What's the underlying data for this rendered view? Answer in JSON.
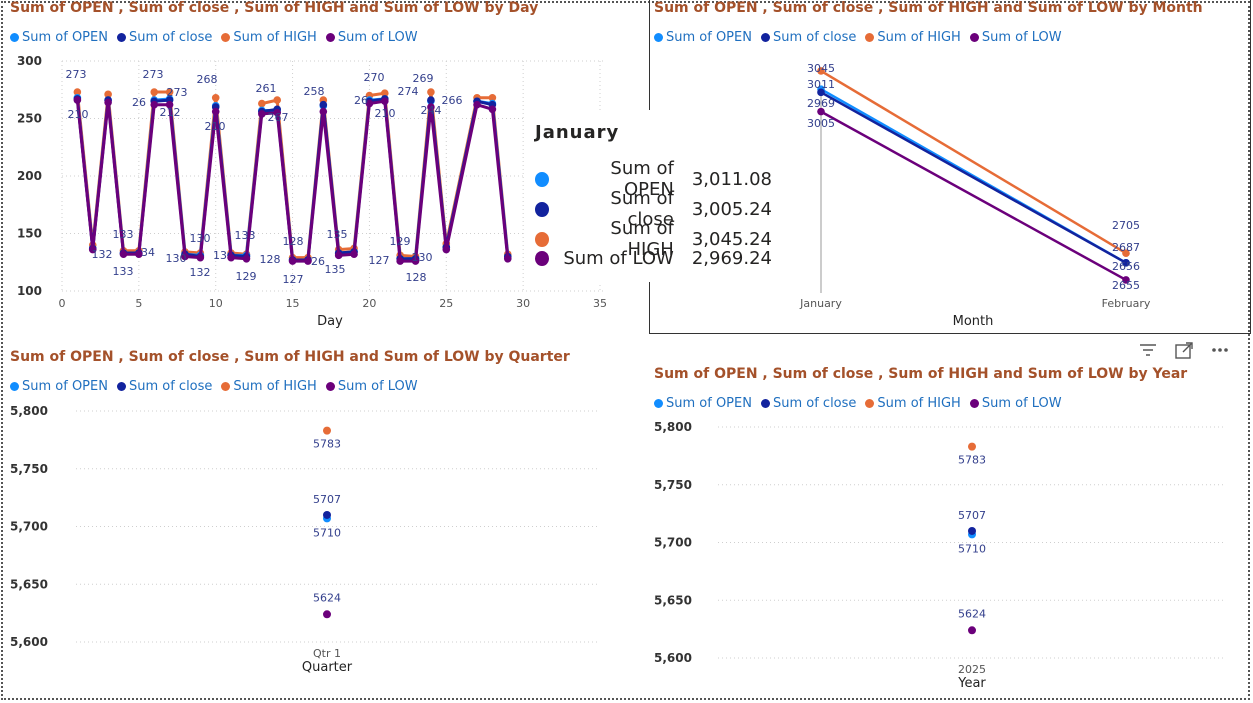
{
  "series_colors": [
    "#118dff",
    "#12239e",
    "#e66c37",
    "#6b007b"
  ],
  "legend_labels": [
    "Sum of OPEN",
    "Sum of close",
    "Sum of HIGH",
    "Sum of LOW"
  ],
  "day_chart": {
    "title": "Sum of OPEN , Sum of close , Sum of HIGH and Sum of LOW by Day",
    "xlabel": "Day",
    "xticks": [
      "0",
      "5",
      "10",
      "15",
      "20",
      "25",
      "30",
      "35"
    ],
    "yticks": [
      "100",
      "150",
      "200",
      "250",
      "300"
    ],
    "top_labels": [
      {
        "day": 1,
        "text": "273"
      },
      {
        "day": 6,
        "text": "273"
      },
      {
        "day": 10,
        "text": "268"
      },
      {
        "day": 14,
        "text": "261"
      },
      {
        "day": 17,
        "text": "258"
      },
      {
        "day": 21,
        "text": "270"
      },
      {
        "day": 24,
        "text": "269"
      }
    ],
    "other_labels": [
      "210",
      "132",
      "133",
      "133",
      "34",
      "26",
      "212",
      "273",
      "130",
      "130",
      "132",
      "210",
      "13",
      "133",
      "129",
      "128",
      "267",
      "128",
      "127",
      "26",
      "135",
      "135",
      "26",
      "210",
      "274",
      "127",
      "129",
      "130",
      "128",
      "244",
      "266"
    ]
  },
  "month_chart": {
    "title": "Sum of OPEN , Sum of close , Sum of HIGH and Sum of LOW by Month",
    "xlabel": "Month",
    "categories": [
      "January",
      "February"
    ],
    "jan_labels": [
      "3045",
      "3011",
      "2969",
      "3005"
    ],
    "feb_labels": [
      "2705",
      "2687",
      "2656",
      "2655"
    ]
  },
  "tooltip": {
    "title": "January",
    "rows": [
      {
        "label": "Sum of OPEN",
        "value": "3,011.08"
      },
      {
        "label": "Sum of close",
        "value": "3,005.24"
      },
      {
        "label": "Sum of HIGH",
        "value": "3,045.24"
      },
      {
        "label": "Sum of LOW",
        "value": "2,969.24"
      }
    ]
  },
  "quarter_chart": {
    "title": "Sum of OPEN , Sum of close , Sum of HIGH and Sum of LOW by Quarter",
    "xlabel": "Quarter",
    "category": "Qtr 1",
    "yticks": [
      "5,800",
      "5,750",
      "5,700",
      "5,650",
      "5,600"
    ],
    "labels": [
      "5783",
      "5707",
      "5710",
      "5624"
    ]
  },
  "year_chart": {
    "title": "Sum of OPEN , Sum of close , Sum of HIGH and Sum of LOW by Year",
    "xlabel": "Year",
    "category": "2025",
    "yticks": [
      "5,800",
      "5,750",
      "5,700",
      "5,650",
      "5,600"
    ],
    "labels": [
      "5783",
      "5707",
      "5710",
      "5624"
    ]
  },
  "chart_data": [
    {
      "type": "line",
      "title": "Sum of OPEN , Sum of close , Sum of HIGH and Sum of LOW by Day",
      "xlabel": "Day",
      "ylabel": "",
      "xlim": [
        0,
        35
      ],
      "ylim": [
        100,
        300
      ],
      "x": [
        1,
        2,
        3,
        4,
        5,
        6,
        7,
        8,
        9,
        10,
        11,
        12,
        13,
        14,
        15,
        16,
        17,
        18,
        19,
        20,
        21,
        22,
        23,
        24,
        25,
        27,
        28,
        29
      ],
      "series": [
        {
          "name": "Sum of OPEN",
          "values": [
            268,
            137,
            266,
            133,
            133,
            266,
            267,
            132,
            131,
            261,
            131,
            131,
            257,
            257,
            127,
            127,
            261,
            133,
            134,
            266,
            267,
            128,
            128,
            265,
            138,
            265,
            263,
            130
          ]
        },
        {
          "name": "Sum of close",
          "values": [
            267,
            137,
            266,
            133,
            133,
            265,
            266,
            132,
            130,
            260,
            131,
            130,
            256,
            258,
            127,
            127,
            262,
            133,
            134,
            265,
            267,
            128,
            128,
            266,
            138,
            265,
            262,
            130
          ]
        },
        {
          "name": "Sum of HIGH",
          "values": [
            273,
            140,
            271,
            135,
            135,
            273,
            273,
            134,
            133,
            268,
            133,
            132,
            263,
            266,
            129,
            129,
            266,
            136,
            137,
            270,
            272,
            131,
            130,
            273,
            141,
            268,
            268,
            132
          ]
        },
        {
          "name": "Sum of LOW",
          "values": [
            266,
            136,
            264,
            132,
            132,
            262,
            262,
            130,
            129,
            256,
            129,
            128,
            254,
            255,
            126,
            126,
            256,
            131,
            132,
            263,
            265,
            126,
            126,
            260,
            136,
            262,
            258,
            128
          ]
        }
      ],
      "grid": true,
      "legend": "top-left"
    },
    {
      "type": "line",
      "title": "Sum of OPEN , Sum of close , Sum of HIGH and Sum of LOW by Month",
      "xlabel": "Month",
      "categories": [
        "January",
        "February"
      ],
      "series": [
        {
          "name": "Sum of OPEN",
          "values": [
            3011.08,
            2687
          ]
        },
        {
          "name": "Sum of close",
          "values": [
            3005.24,
            2687
          ]
        },
        {
          "name": "Sum of HIGH",
          "values": [
            3045.24,
            2705
          ]
        },
        {
          "name": "Sum of LOW",
          "values": [
            2969.24,
            2655
          ]
        }
      ],
      "legend": "top-left"
    },
    {
      "type": "scatter",
      "title": "Sum of OPEN , Sum of close , Sum of HIGH and Sum of LOW by Quarter",
      "xlabel": "Quarter",
      "categories": [
        "Qtr 1"
      ],
      "ylim": [
        5600,
        5800
      ],
      "series": [
        {
          "name": "Sum of OPEN",
          "values": [
            5707
          ]
        },
        {
          "name": "Sum of close",
          "values": [
            5710
          ]
        },
        {
          "name": "Sum of HIGH",
          "values": [
            5783
          ]
        },
        {
          "name": "Sum of LOW",
          "values": [
            5624
          ]
        }
      ],
      "legend": "top-left"
    },
    {
      "type": "scatter",
      "title": "Sum of OPEN , Sum of close , Sum of HIGH and Sum of LOW by Year",
      "xlabel": "Year",
      "categories": [
        "2025"
      ],
      "ylim": [
        5600,
        5800
      ],
      "series": [
        {
          "name": "Sum of OPEN",
          "values": [
            5707
          ]
        },
        {
          "name": "Sum of close",
          "values": [
            5710
          ]
        },
        {
          "name": "Sum of HIGH",
          "values": [
            5783
          ]
        },
        {
          "name": "Sum of LOW",
          "values": [
            5624
          ]
        }
      ],
      "legend": "top-left"
    }
  ]
}
